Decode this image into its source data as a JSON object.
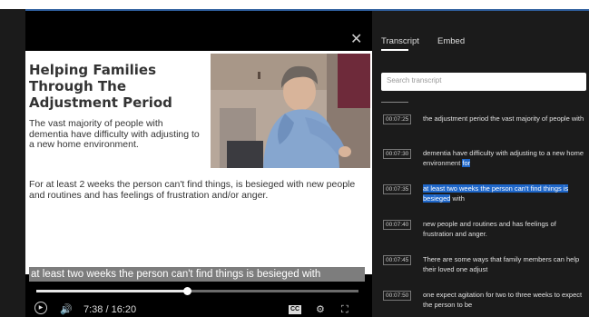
{
  "slide": {
    "title": "Helping Families Through The Adjustment Period",
    "p1": "The vast majority of people with dementia have difficulty with adjusting to a new home environment.",
    "p2": "For at least 2 weeks the person can't find things, is besieged with new people and routines and has feelings of frustration and/or anger."
  },
  "player": {
    "caption": "at least two weeks the person can't find things is besieged with",
    "current_time": "7:38",
    "duration": "16:20",
    "time_sep": " / ",
    "progress_fraction": 0.467
  },
  "icons": {
    "close": "✕",
    "play": "▶",
    "volume": "🔊",
    "cc": "CC",
    "settings": "⚙",
    "fullscreen": "⛶"
  },
  "panel": {
    "tabs": [
      "Transcript",
      "Embed"
    ],
    "search_placeholder": "Search transcript",
    "entries": [
      {
        "time": "00:07:25",
        "text": "the adjustment period the vast majority of people with"
      },
      {
        "time": "00:07:30",
        "pre": "dementia have difficulty with adjusting to a new home environment ",
        "hl": "for",
        "post": ""
      },
      {
        "time": "00:07:35",
        "pre": "",
        "hl": "at least two weeks the person can't find things is besieged",
        "post": " with"
      },
      {
        "time": "00:07:40",
        "text": "new people and routines and has feelings of frustration and anger."
      },
      {
        "time": "00:07:45",
        "text": "There are some ways that family members can help their loved one adjust"
      },
      {
        "time": "00:07:50",
        "text": "one expect agitation for two to three weeks to expect the person to be"
      }
    ]
  }
}
